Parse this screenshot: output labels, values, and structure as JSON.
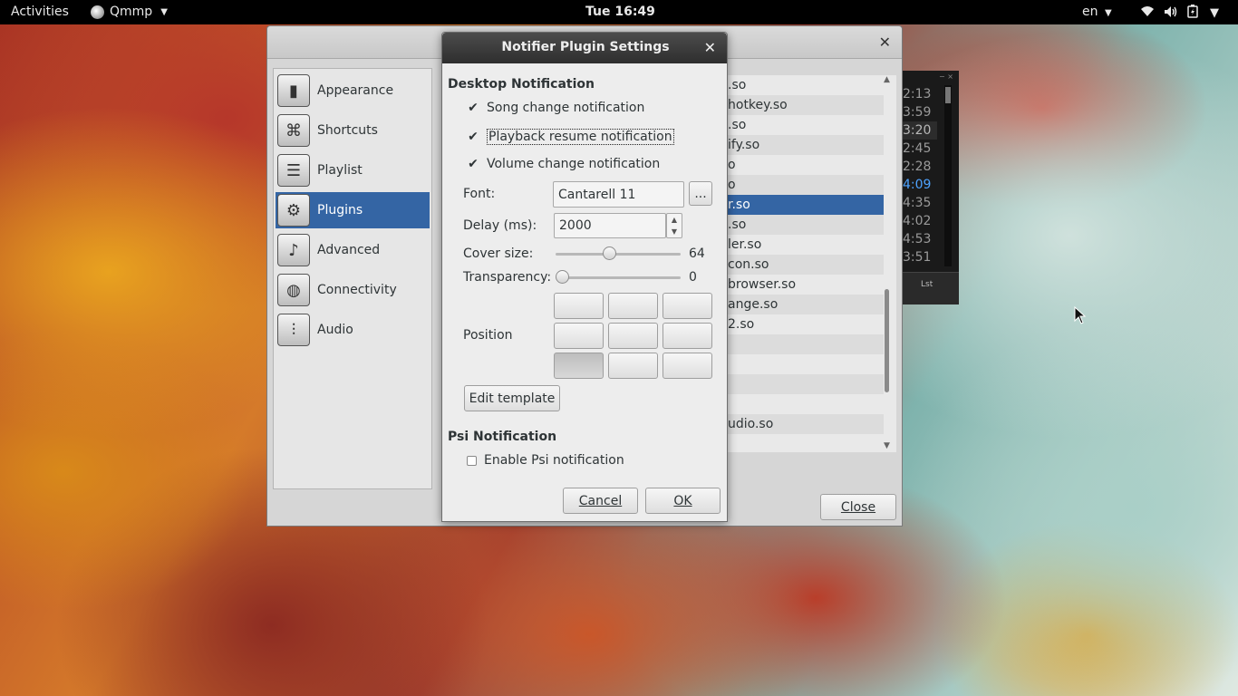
{
  "topbar": {
    "activities": "Activities",
    "app_name": "Qmmp",
    "clock": "Tue 16:49",
    "language": "en",
    "icons": [
      "wifi-icon",
      "volume-icon",
      "battery-icon"
    ]
  },
  "settings_window": {
    "sidebar": [
      {
        "label": "Appearance",
        "icon": "appearance-icon"
      },
      {
        "label": "Shortcuts",
        "icon": "shortcuts-icon"
      },
      {
        "label": "Playlist",
        "icon": "playlist-icon"
      },
      {
        "label": "Plugins",
        "icon": "plugins-icon",
        "selected": true
      },
      {
        "label": "Advanced",
        "icon": "advanced-icon"
      },
      {
        "label": "Connectivity",
        "icon": "connectivity-icon"
      },
      {
        "label": "Audio",
        "icon": "audio-icon"
      }
    ],
    "plugin_rows": [
      ".so",
      "hotkey.so",
      ".so",
      "ify.so",
      "o",
      "o",
      "r.so",
      ".so",
      "ler.so",
      "con.so",
      "browser.so",
      "ange.so",
      "2.so",
      "",
      "",
      "",
      "",
      "udio.so"
    ],
    "selected_row": 6,
    "close_label": "Close"
  },
  "mini_player": {
    "times": [
      "2:13",
      "3:59",
      "3:20",
      "2:45",
      "2:28",
      "4:09",
      "4:35",
      "4:02",
      "4:53",
      "3:51"
    ],
    "highlight_index": 2,
    "current_index": 5,
    "lst_label": "Lst"
  },
  "dialog": {
    "title": "Notifier Plugin Settings",
    "desktop_section": "Desktop Notification",
    "song_change": "Song change notification",
    "playback_resume": "Playback resume notification",
    "volume_change": "Volume change notification",
    "font_label": "Font:",
    "font_value": "Cantarell 11",
    "font_button": "...",
    "delay_label": "Delay (ms):",
    "delay_value": "2000",
    "cover_label": "Cover size:",
    "cover_value": "64",
    "cover_fraction": 0.42,
    "transparency_label": "Transparency:",
    "transparency_value": "0",
    "transparency_fraction": 0,
    "position_label": "Position",
    "position_selected": "bottom-left",
    "edit_template": "Edit template",
    "psi_section": "Psi Notification",
    "psi_enable": "Enable Psi notification",
    "cancel": "Cancel",
    "ok": "OK"
  }
}
